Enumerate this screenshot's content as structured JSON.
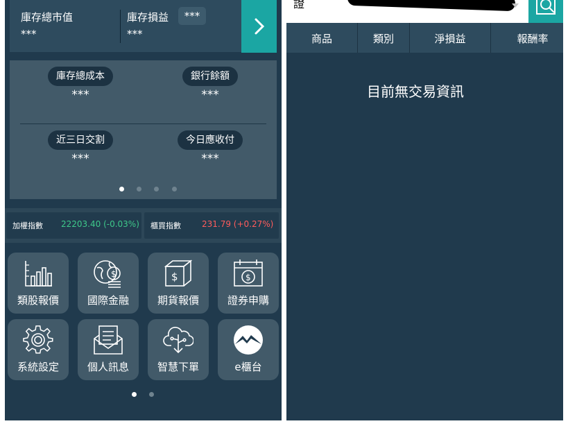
{
  "left": {
    "summary": {
      "inventory_market_value_label": "庫存總市值",
      "inventory_market_value": "***",
      "inventory_pnl_label": "庫存損益",
      "inventory_pnl_badge": "***",
      "inventory_pnl": "***"
    },
    "balances": [
      {
        "label": "庫存總成本",
        "value": "***"
      },
      {
        "label": "銀行餘額",
        "value": "***"
      },
      {
        "label": "近三日交割",
        "value": "***"
      },
      {
        "label": "今日應收付",
        "value": "***"
      }
    ],
    "indices": [
      {
        "name": "加權指數",
        "value": "22203.40 (-0.03%)",
        "color": "#3ec98a"
      },
      {
        "name": "櫃買指數",
        "value": "231.79 (+0.27%)",
        "color": "#ff5c5c"
      }
    ],
    "menu": [
      {
        "label": "類股報價",
        "icon": "bar-chart-icon"
      },
      {
        "label": "國際金融",
        "icon": "globe-coins-icon"
      },
      {
        "label": "期貨報價",
        "icon": "box-dollar-icon"
      },
      {
        "label": "證券申購",
        "icon": "calendar-dollar-icon"
      },
      {
        "label": "系統設定",
        "icon": "gear-icon"
      },
      {
        "label": "個人訊息",
        "icon": "envelope-icon"
      },
      {
        "label": "智慧下單",
        "icon": "cloud-download-icon"
      },
      {
        "label": "e櫃台",
        "icon": "mountain-logo-icon"
      }
    ]
  },
  "right": {
    "search_text": "證",
    "table_headers": [
      "商品",
      "類別",
      "淨損益",
      "報酬率"
    ],
    "empty_message": "目前無交易資訊"
  },
  "colors": {
    "background": "#203a4d",
    "card": "#425a69",
    "accent": "#1ba6a3",
    "down": "#3ec98a",
    "up": "#ff5c5c"
  }
}
